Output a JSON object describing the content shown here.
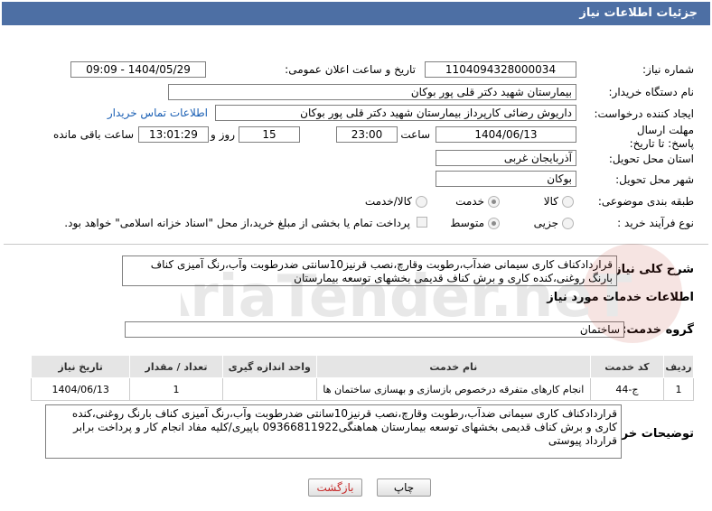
{
  "header": {
    "title": "جزئیات اطلاعات نیاز"
  },
  "labels": {
    "need_number": "شماره نیاز:",
    "announce_datetime": "تاریخ و ساعت اعلان عمومی:",
    "buyer_org": "نام دستگاه خریدار:",
    "requester": "ایجاد کننده درخواست:",
    "contact_link": "اطلاعات تماس خریدار",
    "deadline": "مهلت ارسال پاسخ: تا تاریخ:",
    "time_word": "ساعت",
    "and_word": "روز و",
    "remaining": "ساعت باقی مانده",
    "province": "استان محل تحویل:",
    "city": "شهر محل تحویل:",
    "category": "طبقه بندی موضوعی:",
    "process": "نوع فرآیند خرید :",
    "general_desc": "شرح کلی نیاز:",
    "services_info": "اطلاعات خدمات مورد نیاز",
    "service_group": "گروه خدمت:",
    "buyer_notes": "توضیحات خریدار:"
  },
  "values": {
    "need_number": "1104094328000034",
    "announce_datetime": "1404/05/29 - 09:09",
    "buyer_org": "بیمارستان شهید دکتر قلی پور بوکان",
    "requester": "داریوش رضائی کارپرداز بیمارستان شهید دکتر قلی پور بوکان",
    "deadline_date": "1404/06/13",
    "deadline_time": "23:00",
    "days": "15",
    "remaining_time": "13:01:29",
    "province": "آذربایجان غربی",
    "city": "بوکان",
    "general_desc": "قراردادکناف کاری سیمانی ضدآب،رطوبت وقارچ،نصب قرنیز10سانتی ضدرطوبت وآب،رنگ آمیزی کناف بارنگ روغنی،کنده کاری و برش کناف قدیمی بخشهای توسعه بیمارستان",
    "service_group": "ساختمان",
    "buyer_notes": "قراردادکناف کاری سیمانی ضدآب،رطوبت وقارچ،نصب قرنیز10سانتی ضدرطوبت وآب،رنگ آمیزی کناف بارنگ روغنی،کنده کاری و برش کناف قدیمی بخشهای توسعه بیمارستان هماهنگی09366811922 باپیری/کلیه مفاد انجام کار و پرداخت برابر قرارداد پیوستی"
  },
  "category_options": [
    {
      "label": "کالا",
      "selected": false
    },
    {
      "label": "خدمت",
      "selected": true
    },
    {
      "label": "کالا/خدمت",
      "selected": false
    }
  ],
  "process_options": [
    {
      "label": "جزیی",
      "selected": false
    },
    {
      "label": "متوسط",
      "selected": true
    }
  ],
  "payment_note": "پرداخت تمام یا بخشی از مبلغ خرید،از محل \"اسناد خزانه اسلامی\" خواهد بود.",
  "table": {
    "headers": [
      "ردیف",
      "کد خدمت",
      "نام خدمت",
      "واحد اندازه گیری",
      "تعداد / مقدار",
      "تاریخ نیاز"
    ],
    "rows": [
      [
        "1",
        "ج-44",
        "انجام کارهای متفرقه درخصوص بازسازی و بهسازی ساختمان ها",
        "",
        "1",
        "1404/06/13"
      ]
    ]
  },
  "buttons": {
    "print": "چاپ",
    "back": "بازگشت"
  },
  "watermark_text": "AriaTender.neT"
}
